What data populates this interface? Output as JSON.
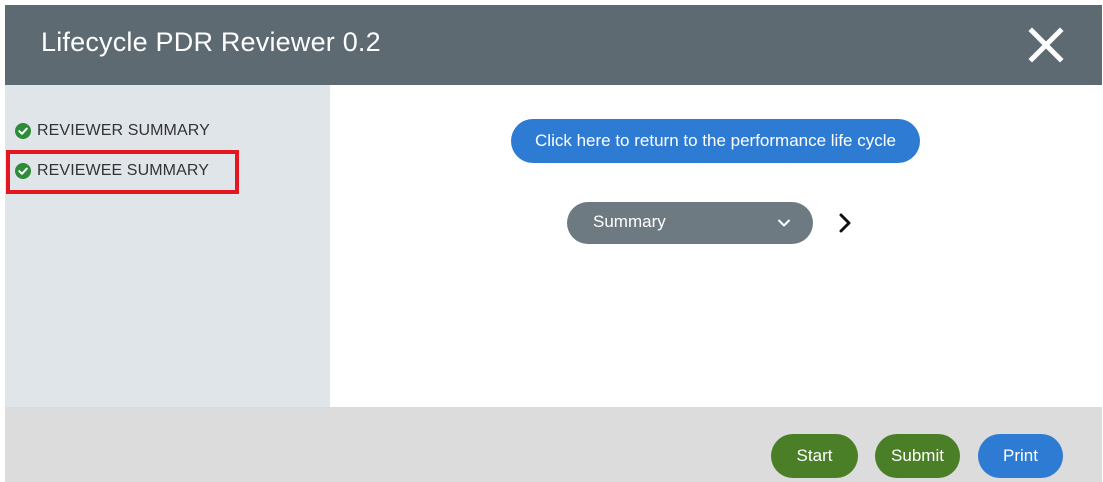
{
  "header": {
    "title": "Lifecycle PDR Reviewer 0.2",
    "close_icon": "close-icon"
  },
  "sidebar": {
    "items": [
      {
        "label": "REVIEWER SUMMARY",
        "icon": "check-circle-icon",
        "status_color": "#2e8b3a"
      },
      {
        "label": "REVIEWEE SUMMARY",
        "icon": "check-circle-icon",
        "status_color": "#2e8b3a",
        "highlighted": true
      }
    ],
    "highlight_color": "#e4161f"
  },
  "main": {
    "return_button_label": "Click here to return to the performance life cycle",
    "section_select": {
      "selected": "Summary",
      "icon": "chevron-down-icon"
    },
    "next_icon": "chevron-right-icon"
  },
  "footer": {
    "start_label": "Start",
    "submit_label": "Submit",
    "print_label": "Print"
  },
  "colors": {
    "header_bg": "#5d6a72",
    "sidebar_bg": "#e0e5e9",
    "footer_bg": "#dcdcdc",
    "primary_blue": "#2e7bd3",
    "action_green": "#4a7f27",
    "select_gray": "#6e7a82"
  }
}
